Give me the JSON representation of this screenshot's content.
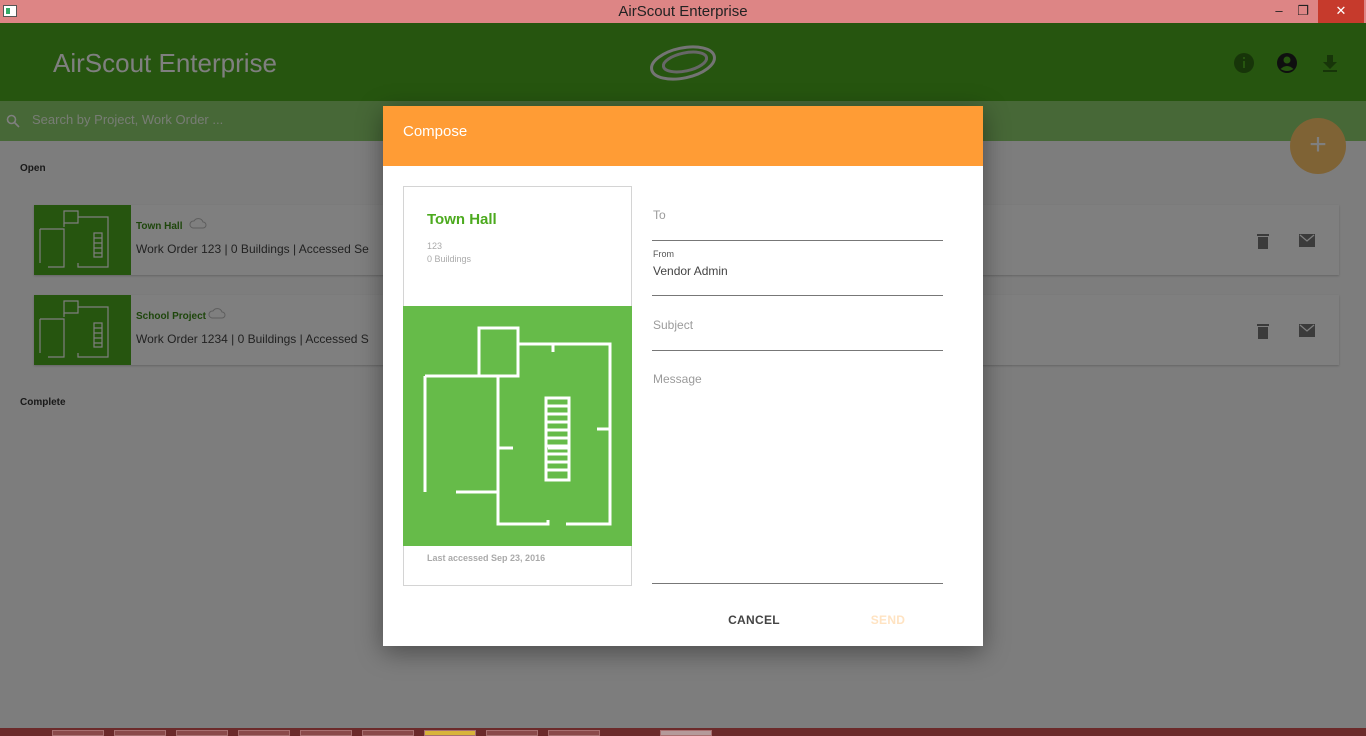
{
  "window": {
    "title": "AirScout Enterprise",
    "min_glyph": "‒",
    "max_glyph": "❐",
    "close_glyph": "✕"
  },
  "appbar": {
    "title": "AirScout Enterprise",
    "color": "#4caa1e",
    "icons": [
      "info-icon",
      "account-circle-icon",
      "download-icon"
    ]
  },
  "search": {
    "placeholder": "Search by Project, Work Order ..."
  },
  "fab": {
    "label": "+"
  },
  "sections": {
    "open": "Open",
    "complete": "Complete"
  },
  "projects": [
    {
      "name": "Town Hall",
      "meta": "Work Order 123  |   0 Buildings   |   Accessed Se"
    },
    {
      "name": "School Project",
      "meta": "Work Order 1234  |   0 Buildings   |   Accessed S"
    }
  ],
  "dialog": {
    "title": "Compose",
    "header_color": "#ff9c35",
    "card": {
      "title": "Town Hall",
      "work_order": "123",
      "buildings": "0 Buildings",
      "last_accessed": "Last accessed Sep 23, 2016"
    },
    "to": {
      "placeholder": "To",
      "value": ""
    },
    "from": {
      "label": "From",
      "value": "Vendor Admin"
    },
    "subject": {
      "placeholder": "Subject",
      "value": ""
    },
    "message": {
      "placeholder": "Message",
      "value": ""
    },
    "cancel_label": "CANCEL",
    "send_label": "SEND"
  }
}
